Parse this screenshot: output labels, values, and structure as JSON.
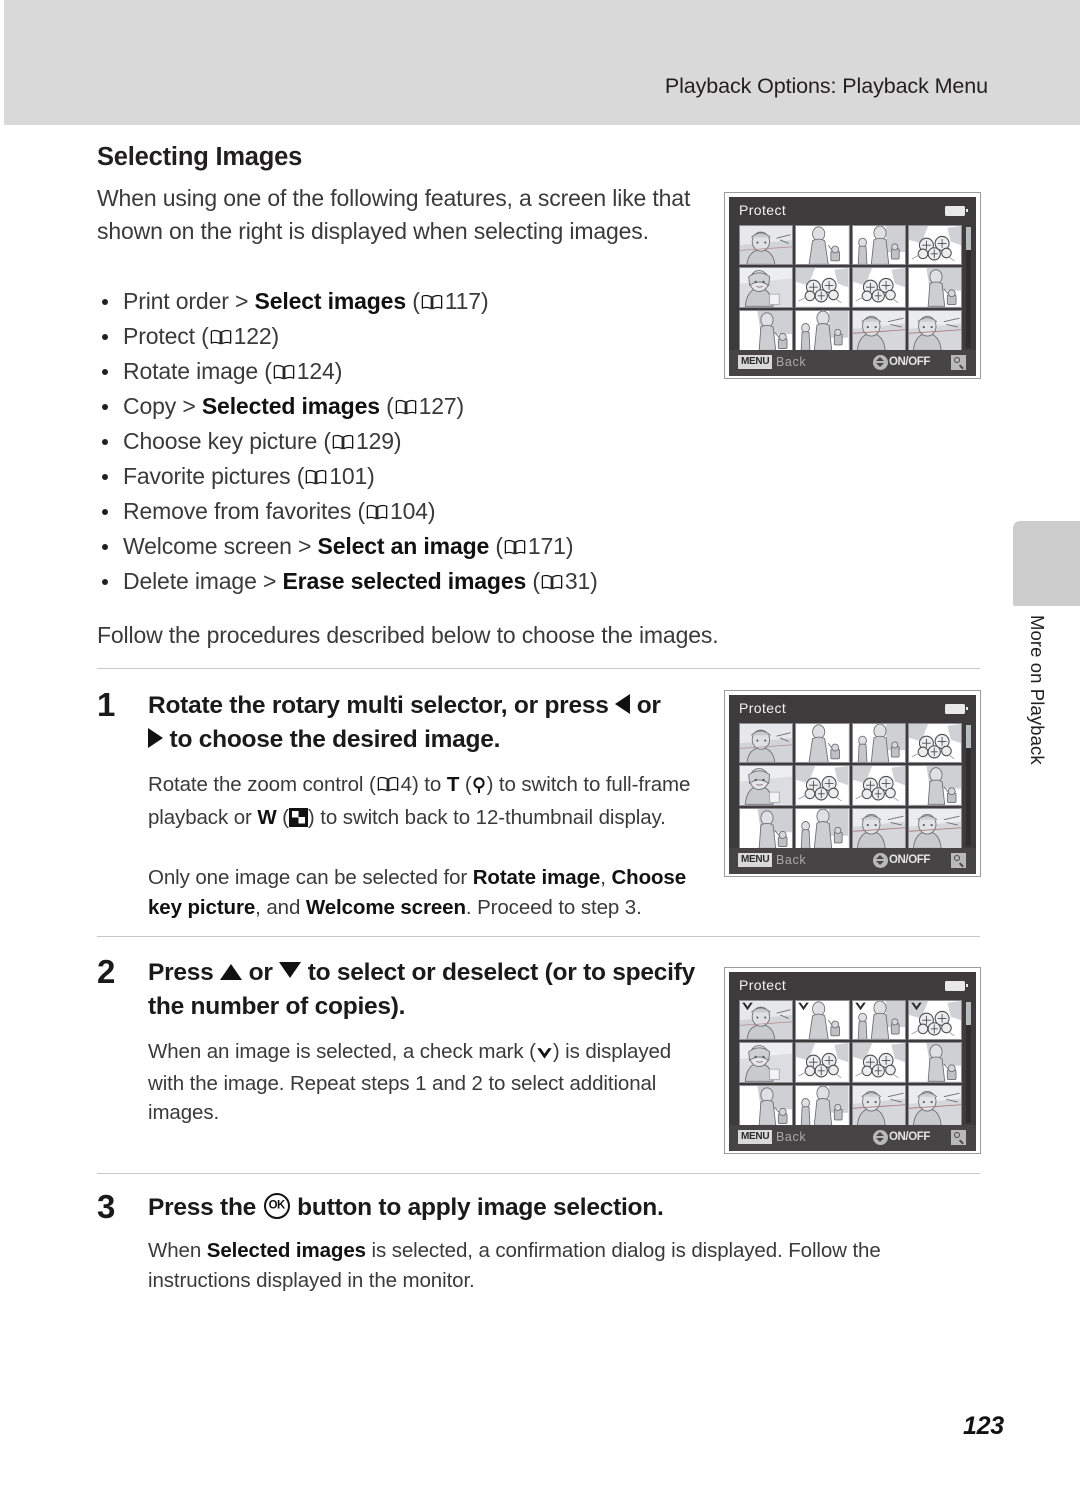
{
  "header": {
    "title": "Playback Options: Playback Menu"
  },
  "side_tab": {
    "label": "More on Playback"
  },
  "section": {
    "title": "Selecting Images",
    "intro": "When using one of the following features, a screen like that shown on the right is displayed when selecting images.",
    "follow": "Follow the procedures described below to choose the images."
  },
  "features": [
    {
      "text_before": "Print order > ",
      "bold": "Select images",
      "page_ref": "117"
    },
    {
      "text_before": "Protect ",
      "bold": "",
      "page_ref": "122"
    },
    {
      "text_before": "Rotate image ",
      "bold": "",
      "page_ref": "124"
    },
    {
      "text_before": "Copy > ",
      "bold": "Selected images",
      "page_ref": "127"
    },
    {
      "text_before": "Choose key picture ",
      "bold": "",
      "page_ref": "129"
    },
    {
      "text_before": "Favorite pictures ",
      "bold": "",
      "page_ref": "101"
    },
    {
      "text_before": "Remove from favorites ",
      "bold": "",
      "page_ref": "104"
    },
    {
      "text_before": "Welcome screen > ",
      "bold": "Select an image",
      "page_ref": "171"
    },
    {
      "text_before": "Delete image > ",
      "bold": "Erase selected images",
      "page_ref": "31"
    }
  ],
  "steps": {
    "one": {
      "number": "1",
      "head_part1": "Rotate the rotary multi selector, or press ",
      "head_part2": " or",
      "head_part3": " to choose the desired image.",
      "body1_p1": "Rotate the zoom control (",
      "body1_ref": "4",
      "body1_p2": ") to ",
      "body1_t": "T",
      "body1_p3": " (",
      "body1_p4": ") to switch to full-frame playback or ",
      "body1_w": "W",
      "body1_p5": " (",
      "body1_p6": ") to switch back to 12-thumbnail display.",
      "body2_p1": "Only one image can be selected for ",
      "body2_b1": "Rotate image",
      "body2_p2": ", ",
      "body2_b2": "Choose key picture",
      "body2_p3": ", and ",
      "body2_b3": "Welcome screen",
      "body2_p4": ". Proceed to step 3."
    },
    "two": {
      "number": "2",
      "head_part1": "Press ",
      "head_part2": " or ",
      "head_part3": " to select or deselect (or to specify the number of copies).",
      "body1_p1": "When an image is selected, a check mark (",
      "body1_p2": ") is displayed with the image. Repeat steps 1 and 2 to select additional images."
    },
    "three": {
      "number": "3",
      "head_part1": "Press the ",
      "head_ok": "OK",
      "head_part2": " button to apply image selection.",
      "body1_p1": "When ",
      "body1_b1": "Selected images",
      "body1_p2": " is selected, a confirmation dialog is displayed. Follow the instructions displayed in the monitor."
    }
  },
  "camera_screens": {
    "title": "Protect",
    "back_chip": "MENU",
    "back_label": "Back",
    "onoff_label": "ON/OFF",
    "screen1_checks": [
      false,
      false,
      false,
      false,
      false,
      false,
      false,
      false,
      false,
      false,
      false,
      false
    ],
    "screen2_checks": [
      false,
      false,
      false,
      false,
      false,
      false,
      false,
      false,
      false,
      false,
      false,
      false
    ],
    "screen3_checks": [
      true,
      true,
      true,
      true,
      false,
      false,
      false,
      false,
      false,
      false,
      false,
      false
    ]
  },
  "footer": {
    "page_number": "123"
  },
  "colors": {
    "header_band": "#d9d9d9",
    "side_tab": "#cdcdcd",
    "screen_bg": "#3e3b3c",
    "screen_bottom_bar": "#474446",
    "text": "#3a3a3a"
  }
}
